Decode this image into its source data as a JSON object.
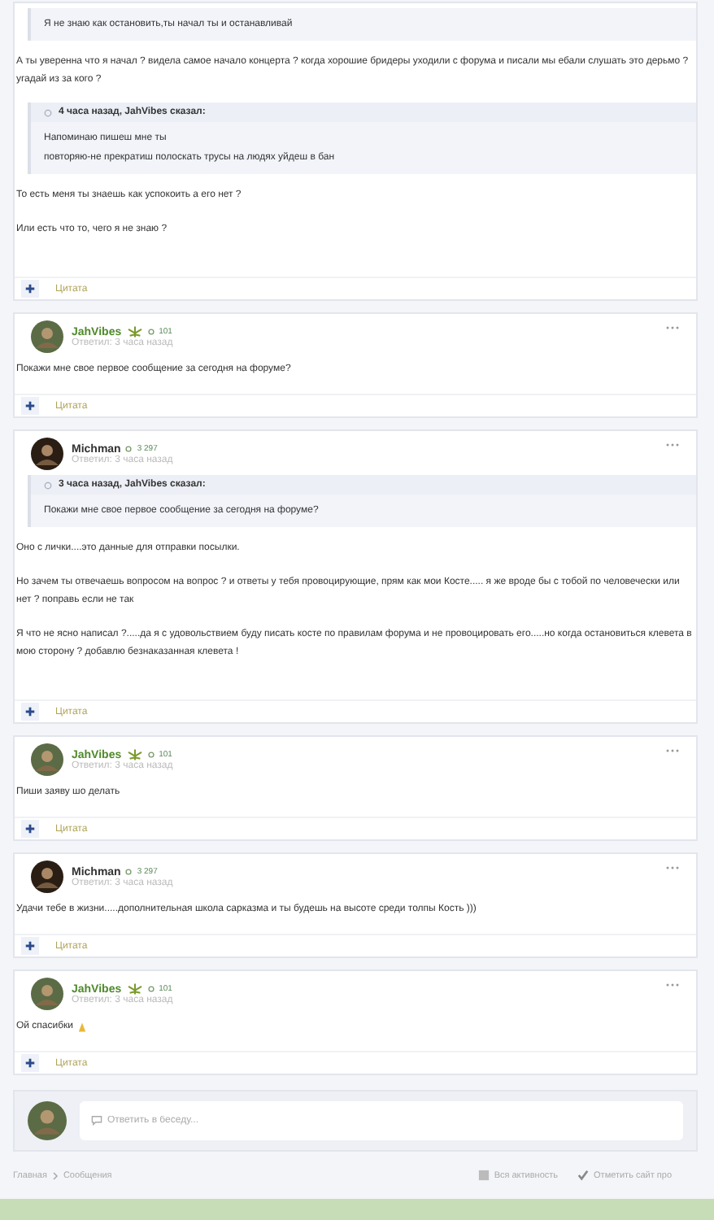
{
  "posts": [
    {
      "blocks": [
        {
          "kind": "quote",
          "lines": [
            "Я не знаю как остановить,ты начал ты и останавливай"
          ]
        },
        {
          "kind": "p",
          "text": "А ты уверенна что я начал ?  видела самое начало концерта ? когда хорошие бридеры уходили с форума и писали мы ебали слушать это дерьмо ?  угадай из за кого ?"
        },
        {
          "kind": "quote",
          "title": "4 часа назад, JahVibes сказал:",
          "lines": [
            "Напоминаю пишеш мне ты",
            "повторяю-не прекратиш полоскать трусы на людях уйдеш в бан"
          ]
        },
        {
          "kind": "p",
          "text": "То есть меня ты знаешь как успокоить а его нет ?"
        },
        {
          "kind": "p",
          "text": "Или есть что то, чего я не знаю ?"
        }
      ],
      "quote_label": "Цитата",
      "tall": true
    },
    {
      "header": {
        "author": "JahVibes",
        "color": "#4f8a2b",
        "avatar": {
          "color": "#5b6b45"
        },
        "leaf": true,
        "reputation": "101",
        "time": "Ответил: 3 часа назад"
      },
      "blocks": [
        {
          "kind": "p",
          "text": "Покажи мне свое первое сообщение за сегодня на форуме?"
        }
      ],
      "quote_label": "Цитата",
      "tall": false
    },
    {
      "header": {
        "author": "Michman",
        "color": "#333333",
        "avatar": {
          "color": "#2a1d14"
        },
        "leaf": false,
        "reputation": "3 297",
        "time": "Ответил: 3 часа назад"
      },
      "blocks": [
        {
          "kind": "quote",
          "title": "3 часа назад, JahVibes сказал:",
          "lines": [
            "Покажи мне свое первое сообщение за сегодня на форуме?"
          ]
        },
        {
          "kind": "p",
          "text": "Оно с лички....это данные для отправки посылки."
        },
        {
          "kind": "p",
          "text": "Но зачем ты отвечаешь вопросом на вопрос ?  и ответы у тебя провоцирующие, прям как мои Косте..... я же вроде бы с тобой по человечески или нет ? поправь если не так"
        },
        {
          "kind": "p",
          "text": "Я что не ясно написал ?.....да я с удовольствием буду писать косте по правилам форума и не провоцировать его.....но когда остановиться клевета в мою сторону ? добавлю безнаказанная клевета !"
        }
      ],
      "quote_label": "Цитата",
      "tall": true
    },
    {
      "header": {
        "author": "JahVibes",
        "color": "#4f8a2b",
        "avatar": {
          "color": "#5b6b45"
        },
        "leaf": true,
        "reputation": "101",
        "time": "Ответил: 3 часа назад"
      },
      "blocks": [
        {
          "kind": "p",
          "text": "Пиши заяву шо делать"
        }
      ],
      "quote_label": "Цитата",
      "tall": false
    },
    {
      "header": {
        "author": "Michman",
        "color": "#333333",
        "avatar": {
          "color": "#2a1d14"
        },
        "leaf": false,
        "reputation": "3 297",
        "time": "Ответил: 3 часа назад"
      },
      "blocks": [
        {
          "kind": "p",
          "text": "Удачи тебе в жизни.....дополнительная школа сарказма и ты будешь на высоте среди толпы Кость )))"
        }
      ],
      "quote_label": "Цитата",
      "tall": false
    },
    {
      "header": {
        "author": "JahVibes",
        "color": "#4f8a2b",
        "avatar": {
          "color": "#5b6b45"
        },
        "leaf": true,
        "reputation": "101",
        "time": "Ответил: 3 часа назад"
      },
      "blocks": [
        {
          "kind": "p",
          "text": "Ой спасибки",
          "hands": true
        }
      ],
      "quote_label": "Цитата",
      "tall": false
    }
  ],
  "reply": {
    "placeholder": "Ответить в беседу..."
  },
  "footer": {
    "breadcrumbs": [
      "Главная",
      "Сообщения"
    ],
    "links": [
      {
        "kind": "activity",
        "label": "Вся активность"
      },
      {
        "kind": "mark",
        "label": "Отметить сайт про"
      }
    ]
  }
}
